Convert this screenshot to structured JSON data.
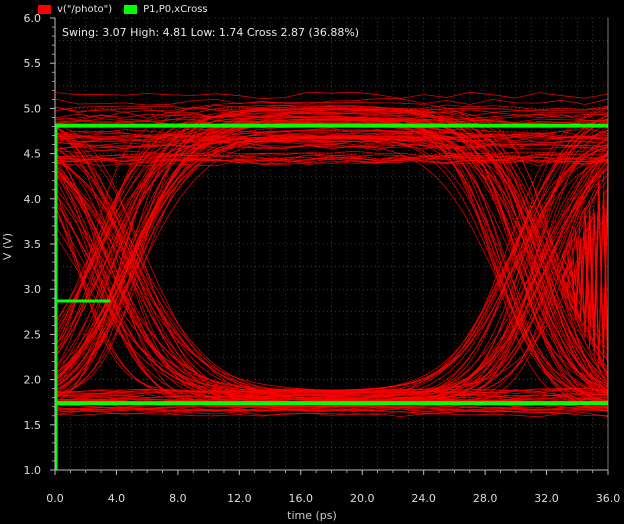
{
  "colors": {
    "background": "#000000",
    "grid": "#5a5a5a",
    "axis": "#bbbbbb",
    "eye": "#ff0000",
    "marker": "#00ff00"
  },
  "chart_data": {
    "type": "line",
    "title": "",
    "annotation": "Swing: 3.07 High: 4.81 Low: 1.74 Cross 2.87 (36.88%)",
    "xlabel": "time (ps)",
    "ylabel": "V (V)",
    "xlim": [
      0,
      36
    ],
    "ylim": [
      1.0,
      6.0
    ],
    "x_ticks": [
      "0.0",
      "4.0",
      "8.0",
      "12.0",
      "16.0",
      "20.0",
      "24.0",
      "28.0",
      "32.0",
      "36.0"
    ],
    "y_ticks": [
      "1.0",
      "1.5",
      "2.0",
      "2.5",
      "3.0",
      "3.5",
      "4.0",
      "4.5",
      "5.0",
      "5.5",
      "6.0"
    ],
    "grid": true,
    "legend_position": "top-left",
    "series": [
      {
        "name": "v(\"/photo\")",
        "color": "#ff0000",
        "kind": "eye-diagram",
        "unit_interval": [
          0,
          36
        ],
        "high_band": [
          4.4,
          5.15
        ],
        "low_band": [
          1.58,
          1.92
        ],
        "crossing_level": 2.87
      },
      {
        "name": "P1,P0,xCross",
        "color": "#00ff00",
        "high": 4.81,
        "low": 1.74,
        "cross": 2.87,
        "cross_time_end": 3.6
      }
    ],
    "metrics": {
      "swing": 3.07,
      "high": 4.81,
      "low": 1.74,
      "cross": 2.87,
      "cross_percent": 36.88
    }
  }
}
